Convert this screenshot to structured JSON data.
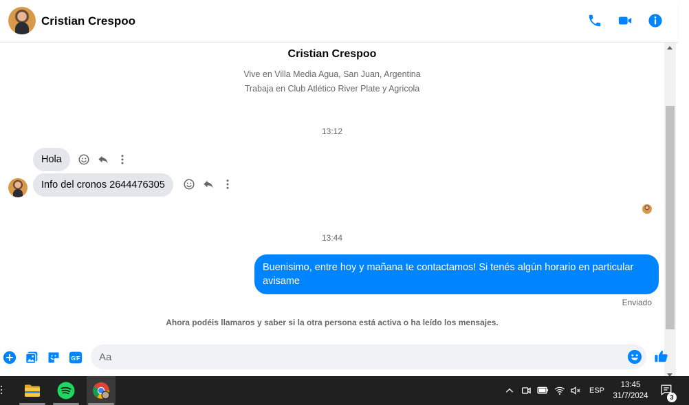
{
  "header": {
    "contact_name": "Cristian Crespoo",
    "icons": [
      "phone-icon",
      "video-icon",
      "info-icon"
    ],
    "accent_color": "#0084ff"
  },
  "profile": {
    "name": "Cristian Crespoo",
    "lives_in": "Vive en Villa Media Agua, San Juan, Argentina",
    "works_at": "Trabaja en Club Atlético River Plate y Agricola"
  },
  "conversation": {
    "timestamp_1": "13:12",
    "incoming": [
      {
        "text": "Hola"
      },
      {
        "text": "Info del cronos 2644476305"
      }
    ],
    "timestamp_2": "13:44",
    "outgoing": [
      {
        "text": "Buenisimo, entre hoy y mañana te contactamos! Si tenés algún horario en particular avisame"
      }
    ],
    "delivery_status": "Enviado",
    "info_note": "Ahora podéis llamaros y saber si la otra persona está activa o ha leído los mensajes."
  },
  "composer": {
    "placeholder": "Aa",
    "icons": [
      "plus-icon",
      "image-icon",
      "sticker-icon",
      "gif-icon",
      "emoji-icon",
      "thumbs-up-icon"
    ],
    "gif_label": "GIF"
  },
  "taskbar": {
    "apps": [
      "file-explorer-icon",
      "spotify-icon",
      "chrome-icon"
    ],
    "language": "ESP",
    "time": "13:45",
    "date": "31/7/2024",
    "notification_count": "3"
  }
}
